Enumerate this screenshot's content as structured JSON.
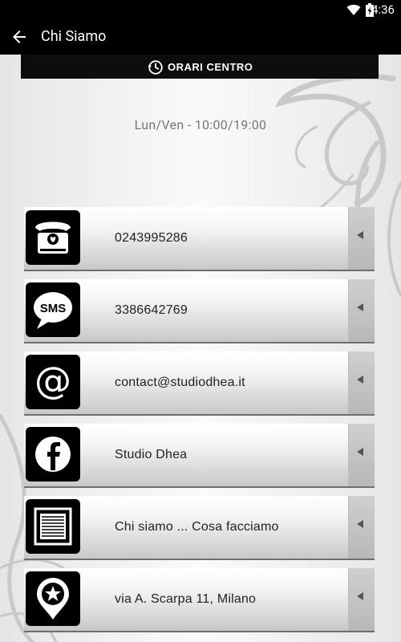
{
  "status_bar": {
    "time": "4:36"
  },
  "action_bar": {
    "title": "Chi Siamo"
  },
  "hours_section": {
    "header_label": "ORARI CENTRO",
    "hours": "Lun/Ven - 10:00/19:00"
  },
  "contacts": [
    {
      "icon": "telephone-heart-icon",
      "label": "0243995286"
    },
    {
      "icon": "sms-bubble-icon",
      "label": "3386642769"
    },
    {
      "icon": "at-sign-icon",
      "label": "contact@studiodhea.it"
    },
    {
      "icon": "facebook-icon",
      "label": "Studio Dhea"
    },
    {
      "icon": "document-icon",
      "label": "Chi siamo ... Cosa facciamo"
    },
    {
      "icon": "map-pin-star-icon",
      "label": "via A. Scarpa 11, Milano"
    }
  ]
}
